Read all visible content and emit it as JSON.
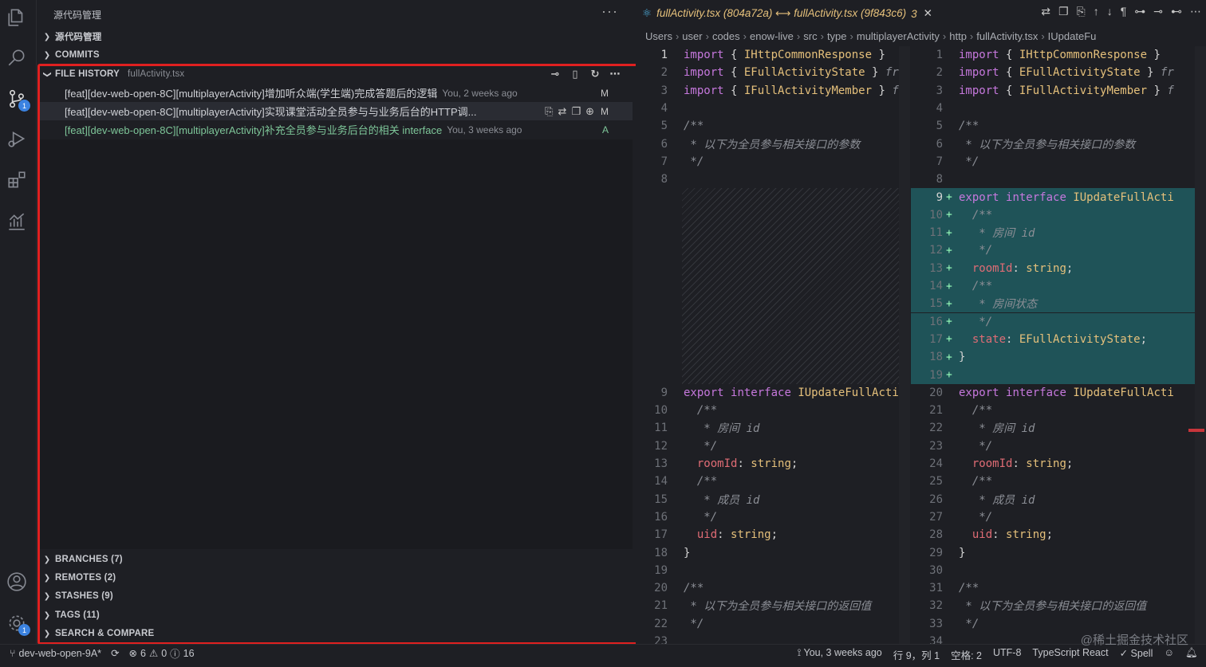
{
  "sidebar": {
    "header_title": "源代码管理",
    "header_more": "···",
    "sections_top": [
      {
        "label": "源代码管理"
      },
      {
        "label": "COMMITS"
      }
    ],
    "file_history": {
      "label": "FILE HISTORY",
      "file": "fullActivity.tsx",
      "commits": [
        {
          "message": "[feat][dev-web-open-8C][multiplayerActivity]增加听众端(学生端)完成答题后的逻辑",
          "meta": "You, 2 weeks ago",
          "status": "M"
        },
        {
          "message": "[feat][dev-web-open-8C][multiplayerActivity]实现课堂活动全员参与与业务后台的HTTP调...",
          "meta": "",
          "status": "M"
        },
        {
          "message": "[feat][dev-web-open-8C][multiplayerActivity]补充全员参与业务后台的相关 interface",
          "meta": "You, 3 weeks ago",
          "status": "A"
        }
      ]
    },
    "sections_bottom": [
      {
        "label": "BRANCHES (7)"
      },
      {
        "label": "REMOTES (2)"
      },
      {
        "label": "STASHES (9)"
      },
      {
        "label": "TAGS (11)"
      },
      {
        "label": "SEARCH & COMPARE"
      }
    ]
  },
  "editor": {
    "tab_title": "fullActivity.tsx (804a72a) ⟷ fullActivity.tsx (9f843c6)",
    "tab_count": "3",
    "breadcrumb": [
      "Users",
      "user",
      "codes",
      "enow-live",
      "src",
      "type",
      "multiplayerActivity",
      "http",
      "fullActivity.tsx",
      "IUpdateFu"
    ]
  },
  "status": {
    "branch": "dev-web-open-9A*",
    "errors": "6",
    "warnings": "0",
    "info": "16",
    "blame": "You, 3 weeks ago",
    "position": "行 9，列 1",
    "spaces": "空格: 2",
    "encoding": "UTF-8",
    "language": "TypeScript React",
    "spell": "✓ Spell"
  },
  "watermark": "@稀土掘金技术社区",
  "colors": {
    "accent_blue": "#3b82e0",
    "highlight_red": "#e02020",
    "added_green": "#7ec699"
  }
}
